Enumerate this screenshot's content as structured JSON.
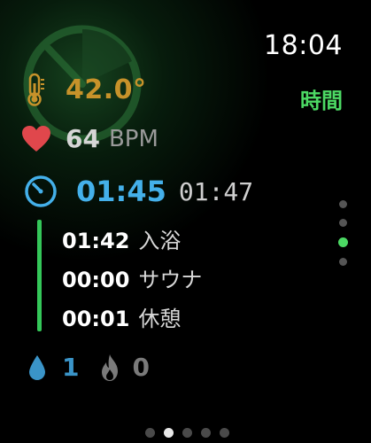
{
  "status": {
    "time": "18:04",
    "mode_label": "時間"
  },
  "metrics": {
    "temperature": "42.0°",
    "heart_rate": "64",
    "heart_rate_unit": "BPM",
    "elapsed": "01:45",
    "total": "01:47"
  },
  "phases": [
    {
      "time": "01:42",
      "label": "入浴"
    },
    {
      "time": "00:00",
      "label": "サウナ"
    },
    {
      "time": "00:01",
      "label": "休憩"
    }
  ],
  "counters": {
    "water": "1",
    "heat": "0"
  },
  "icons": {
    "temperature": "thermometer-icon",
    "heart_rate": "heart-icon",
    "elapsed": "stopwatch-icon",
    "water": "water-drop-icon",
    "heat": "flame-icon",
    "background": "timer-ring-icon"
  },
  "pager": {
    "vertical_count": 4,
    "vertical_active": 2,
    "horizontal_count": 5,
    "horizontal_active": 1
  },
  "colors": {
    "accent_green": "#4cd964",
    "temperature": "#c7922a",
    "heart": "#e0474c",
    "elapsed_blue": "#44b0ea",
    "water_blue": "#3a94c8"
  }
}
